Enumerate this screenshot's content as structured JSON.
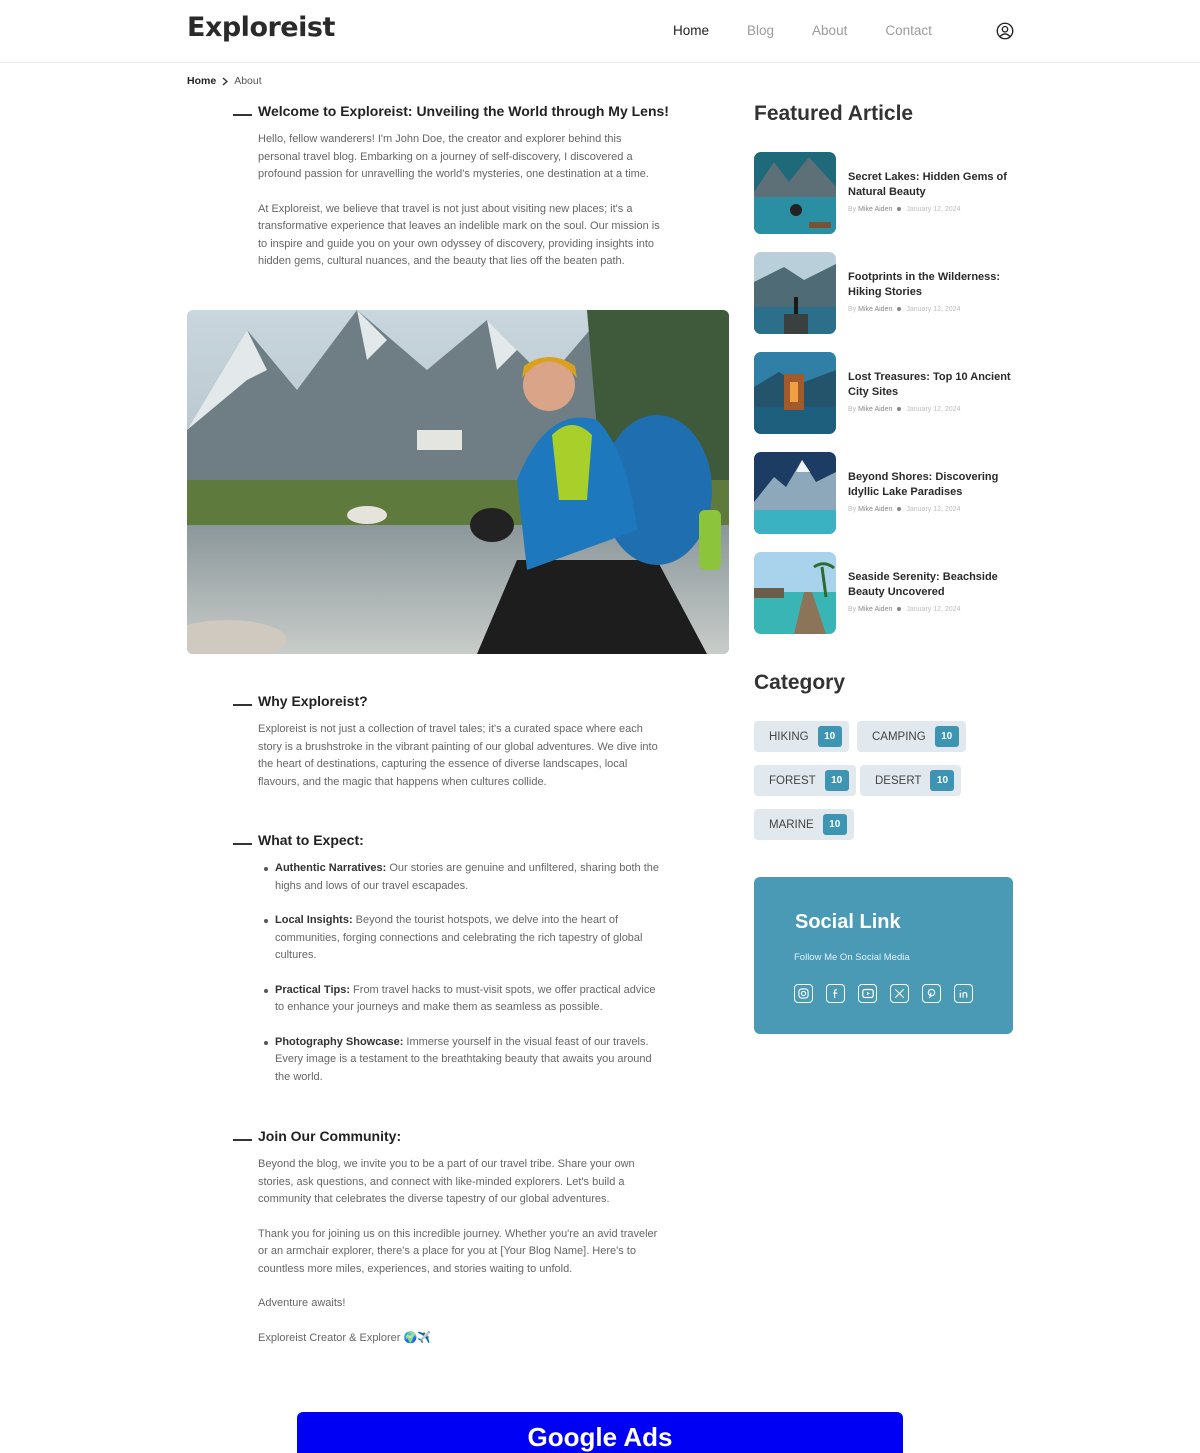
{
  "header": {
    "logo": "Exploreist",
    "nav": [
      {
        "label": "Home",
        "active": true
      },
      {
        "label": "Blog",
        "active": false
      },
      {
        "label": "About",
        "active": false
      },
      {
        "label": "Contact",
        "active": false
      }
    ],
    "user_icon": "user-circle-icon"
  },
  "breadcrumb": {
    "home": "Home",
    "current": "About",
    "separator_icon": "chevron-right-icon"
  },
  "article": {
    "welcome": {
      "heading": "Welcome to Exploreist: Unveiling the World through My Lens!",
      "paragraphs": [
        "Hello, fellow wanderers! I'm John Doe, the creator and explorer behind this personal travel blog. Embarking on a journey of self-discovery, I discovered a profound passion for unravelling the world's mysteries, one destination at a time.",
        "At Exploreist, we believe that travel is not just about visiting new places; it's a transformative experience that leaves an indelible mark on the soul. Our mission is to inspire and guide you on your own odyssey of discovery, providing insights into hidden gems, cultural nuances, and the beauty that lies off the beaten path."
      ]
    },
    "why": {
      "heading": "Why Exploreist?",
      "paragraph": "Exploreist is not just a collection of travel tales; it's a curated space where each story is a brushstroke in the vibrant painting of our global adventures. We dive into the heart of destinations, capturing the essence of diverse landscapes, local flavours, and the magic that happens when cultures collide."
    },
    "expect": {
      "heading": "What to Expect:",
      "items": [
        {
          "bold": "Authentic Narratives:",
          "text": " Our stories are genuine and unfiltered, sharing both the highs and lows of our travel escapades."
        },
        {
          "bold": "Local Insights:",
          "text": " Beyond the tourist hotspots, we delve into the heart of communities, forging connections and celebrating the rich tapestry of global cultures."
        },
        {
          "bold": "Practical Tips:",
          "text": " From travel hacks to must-visit spots, we offer practical advice to enhance your journeys and make them as seamless as possible."
        },
        {
          "bold": "Photography Showcase:",
          "text": " Immerse yourself in the visual feast of our travels. Every image is a testament to the breathtaking beauty that awaits you around the world."
        }
      ]
    },
    "community": {
      "heading": "Join Our Community:",
      "paragraphs": [
        "Beyond the blog, we invite you to be a part of our travel tribe. Share your own stories, ask questions, and connect with like-minded explorers. Let's build a community that celebrates the diverse tapestry of our global adventures.",
        "Thank you for joining us on this incredible journey. Whether you're an avid traveler or an armchair explorer, there's a place for you at [Your Blog Name]. Here's to countless more miles, experiences, and stories waiting to unfold.",
        "Adventure awaits!",
        "Exploreist Creator & Explorer 🌍✈️"
      ]
    }
  },
  "sidebar": {
    "featured_title": "Featured Article",
    "articles": [
      {
        "title": "Secret Lakes: Hidden Gems of Natural Beauty",
        "by": "By",
        "author": "Mike Aiden",
        "date": "January 12, 2024"
      },
      {
        "title": "Footprints in the Wilderness: Hiking Stories",
        "by": "By",
        "author": "Mike Aiden",
        "date": "January 12, 2024"
      },
      {
        "title": "Lost Treasures: Top 10 Ancient City Sites",
        "by": "By",
        "author": "Mike Aiden",
        "date": "January 12, 2024"
      },
      {
        "title": "Beyond Shores: Discovering Idyllic Lake Paradises",
        "by": "By",
        "author": "Mike Aiden",
        "date": "January 12, 2024"
      },
      {
        "title": "Seaside Serenity: Beachside Beauty Uncovered",
        "by": "By",
        "author": "Mike Aiden",
        "date": "January 12, 2024"
      }
    ],
    "category_title": "Category",
    "categories": [
      {
        "name": "HIKING",
        "count": "10"
      },
      {
        "name": "CAMPING",
        "count": "10"
      },
      {
        "name": "FOREST",
        "count": "10"
      },
      {
        "name": "DESERT",
        "count": "10"
      },
      {
        "name": "MARINE",
        "count": "10"
      }
    ],
    "social": {
      "title": "Social Link",
      "subtitle": "Follow Me On Social Media",
      "icons": [
        "instagram-icon",
        "facebook-icon",
        "youtube-icon",
        "x-twitter-icon",
        "pinterest-icon",
        "linkedin-icon"
      ]
    }
  },
  "ads": {
    "label": "Google Ads"
  },
  "colors": {
    "accent": "#4a9ab5",
    "badge": "#3e95b3",
    "ads": "#0000f5",
    "chip": "#e1e8ee"
  }
}
